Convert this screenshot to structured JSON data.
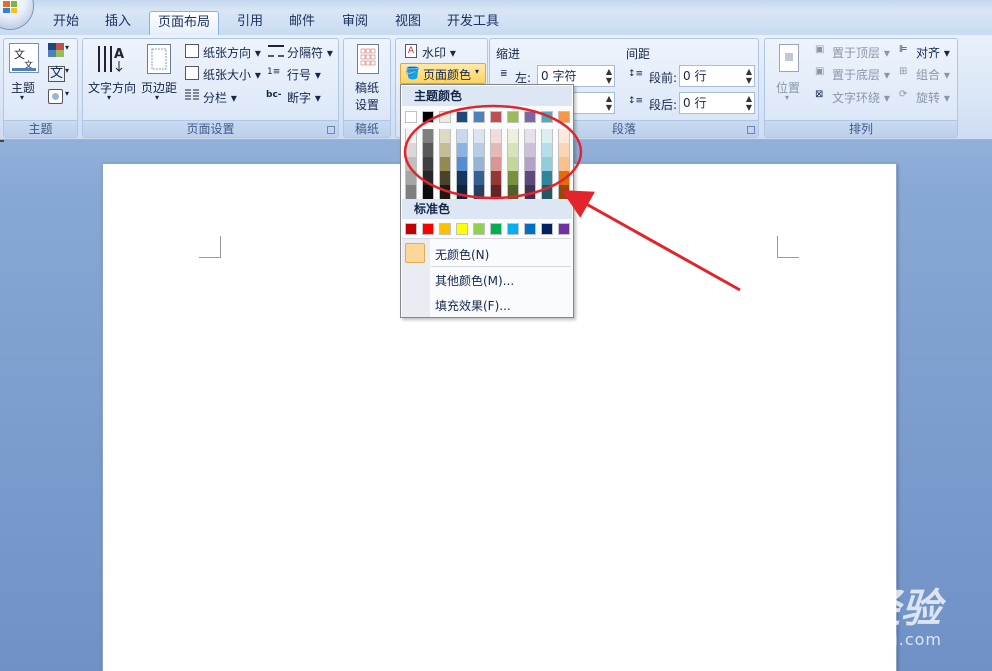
{
  "tabs": [
    "开始",
    "插入",
    "页面布局",
    "引用",
    "邮件",
    "审阅",
    "视图",
    "开发工具"
  ],
  "active_tab": "页面布局",
  "ribbon": {
    "theme_group": {
      "label": "主题",
      "theme_button": "主题",
      "colors_icon": "theme-colors-icon",
      "fonts_glyph": "文",
      "effects_icon": "theme-effects-icon"
    },
    "page_setup_group": {
      "label": "页面设置",
      "text_direction": "文字方向",
      "margins": "页边距",
      "orientation": "纸张方向",
      "size": "纸张大小",
      "columns": "分栏",
      "breaks": "分隔符",
      "line_numbers": "行号",
      "hyphenation": "断字"
    },
    "manuscript_group": {
      "label": "稿纸",
      "manuscript_line1": "稿纸",
      "manuscript_line2": "设置"
    },
    "page_background_group": {
      "watermark": "水印",
      "page_color": "页面颜色"
    },
    "paragraph_group": {
      "label": "段落",
      "indent_title": "缩进",
      "indent_left_label": "左:",
      "indent_left_value": "0 字符",
      "spacing_title": "间距",
      "spacing_before_label": "段前:",
      "spacing_before_value": "0 行",
      "spacing_after_label": "段后:",
      "spacing_after_value": "0 行"
    },
    "arrange_group": {
      "label": "排列",
      "position": "位置",
      "bring_front": "置于顶层",
      "send_back": "置于底层",
      "text_wrap": "文字环绕",
      "align": "对齐",
      "group": "组合",
      "rotate": "旋转"
    }
  },
  "color_menu": {
    "theme_colors_header": "主题颜色",
    "standard_colors_header": "标准色",
    "no_color": "无颜色(N)",
    "more_colors": "其他颜色(M)...",
    "fill_effects": "填充效果(F)...",
    "theme_base": [
      "#ffffff",
      "#000000",
      "#eeece1",
      "#1f497d",
      "#4f81bd",
      "#c0504d",
      "#9bbb59",
      "#8064a2",
      "#4bacc6",
      "#f79646"
    ],
    "theme_shades": [
      [
        "#f2f2f2",
        "#d8d8d8",
        "#bfbfbf",
        "#a5a5a5",
        "#7f7f7f"
      ],
      [
        "#7f7f7f",
        "#595959",
        "#3f3f3f",
        "#262626",
        "#0c0c0c"
      ],
      [
        "#ddd9c3",
        "#c4bd97",
        "#938953",
        "#494429",
        "#1d1b10"
      ],
      [
        "#c6d9f0",
        "#8db3e2",
        "#548dd4",
        "#17365d",
        "#0f243e"
      ],
      [
        "#dbe5f1",
        "#b8cce4",
        "#95b3d7",
        "#366092",
        "#244061"
      ],
      [
        "#f2dcdb",
        "#e5b9b7",
        "#d99694",
        "#953734",
        "#632423"
      ],
      [
        "#ebf1dd",
        "#d7e3bc",
        "#c3d69b",
        "#76923c",
        "#4f6128"
      ],
      [
        "#e5e0ec",
        "#ccc1d9",
        "#b2a2c7",
        "#5f497a",
        "#3f3151"
      ],
      [
        "#dbeef3",
        "#b7dde8",
        "#92cddc",
        "#31859b",
        "#205867"
      ],
      [
        "#fdeada",
        "#fbd5b5",
        "#fac08f",
        "#e36c09",
        "#974806"
      ]
    ],
    "standard": [
      "#c00000",
      "#ff0000",
      "#ffc000",
      "#ffff00",
      "#92d050",
      "#00b050",
      "#00b0f0",
      "#0070c0",
      "#002060",
      "#7030a0"
    ]
  },
  "watermark": {
    "brand": "Baidu经验",
    "url": "jingyan.baidu.com"
  },
  "annotation_color": "#e3242b"
}
